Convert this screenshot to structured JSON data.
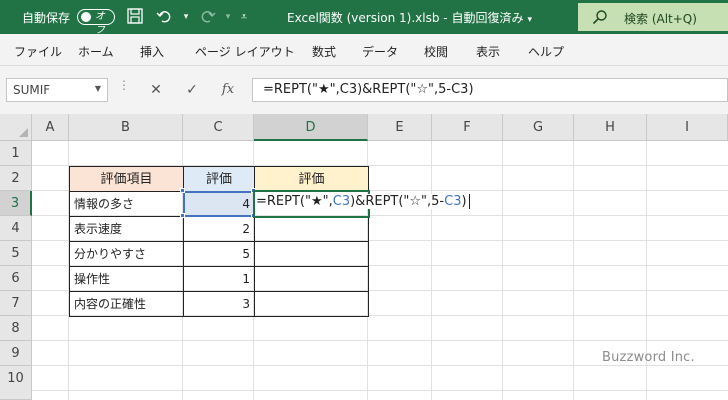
{
  "titlebar": {
    "autosave_label": "自動保存",
    "autosave_state": "オフ",
    "document_title": "Excel関数 (version 1).xlsb  -  自動回復済み",
    "search_placeholder": "検索 (Alt+Q)"
  },
  "menu": {
    "items": [
      "ファイル",
      "ホーム",
      "挿入",
      "ページ レイアウト",
      "数式",
      "データ",
      "校閲",
      "表示",
      "ヘルプ"
    ]
  },
  "formula_bar": {
    "name_box": "SUMIF",
    "fx_label": "fx",
    "formula": "=REPT(\"★\",C3)&REPT(\"☆\",5-C3)"
  },
  "grid": {
    "columns": [
      "A",
      "B",
      "C",
      "D",
      "E",
      "F",
      "G",
      "H",
      "I"
    ],
    "rows": [
      "1",
      "2",
      "3",
      "4",
      "5",
      "6",
      "7",
      "8",
      "9",
      "10"
    ],
    "active_column": "D",
    "active_row": "3"
  },
  "table": {
    "headers": [
      "評価項目",
      "評価",
      "評価"
    ],
    "rows": [
      {
        "item": "情報の多さ",
        "score": "4"
      },
      {
        "item": "表示速度",
        "score": "2"
      },
      {
        "item": "分かりやすさ",
        "score": "5"
      },
      {
        "item": "操作性",
        "score": "1"
      },
      {
        "item": "内容の正確性",
        "score": "3"
      }
    ]
  },
  "editing": {
    "part1": "=REPT(\"★\",",
    "ref1": "C3",
    "part2": ")&REPT(\"☆\",5-",
    "ref2": "C3",
    "part3": ")"
  },
  "watermark": "Buzzword Inc.",
  "colors": {
    "accent": "#217346",
    "header_b": "#fbe4d5",
    "header_c": "#deebf7",
    "header_d": "#fff2cc",
    "reference": "#4472c4"
  }
}
